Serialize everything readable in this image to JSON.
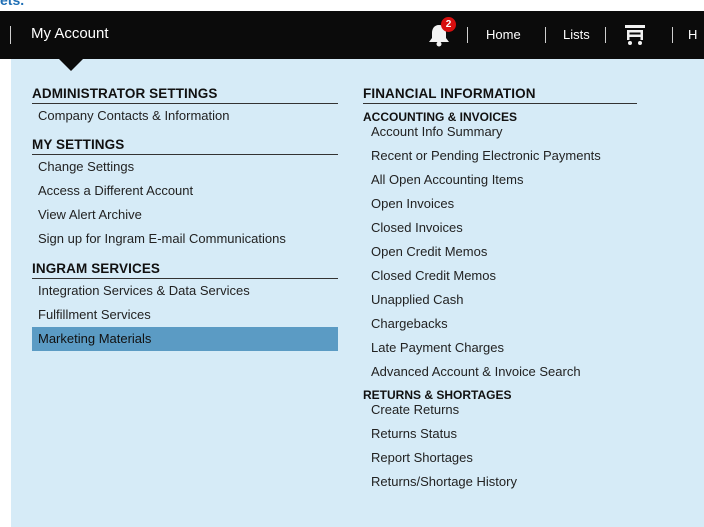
{
  "top_strip": {
    "text": "ets."
  },
  "nav": {
    "account_label": "My Account",
    "notification_count": "2",
    "links": [
      "Home",
      "Lists"
    ],
    "cut_link": "H"
  },
  "admin": {
    "title": "ADMINISTRATOR SETTINGS",
    "items": [
      "Company Contacts & Information"
    ]
  },
  "my_settings": {
    "title": "MY SETTINGS",
    "items": [
      "Change Settings",
      "Access a Different Account",
      "View Alert Archive",
      "Sign up for Ingram E-mail Communications"
    ]
  },
  "ingram_services": {
    "title": "INGRAM SERVICES",
    "items": [
      "Integration Services & Data Services",
      "Fulfillment Services",
      "Marketing Materials"
    ],
    "selected_index": 2
  },
  "financial": {
    "title": "FINANCIAL INFORMATION",
    "accounting": {
      "title": "ACCOUNTING & INVOICES",
      "items": [
        "Account Info Summary",
        "Recent or Pending Electronic Payments",
        "All Open Accounting Items",
        "Open Invoices",
        "Closed Invoices",
        "Open Credit Memos",
        "Closed Credit Memos",
        "Unapplied Cash",
        "Chargebacks",
        "Late Payment Charges",
        "Advanced Account & Invoice Search"
      ]
    },
    "returns": {
      "title": "RETURNS & SHORTAGES",
      "items": [
        "Create Returns",
        "Returns Status",
        "Report Shortages",
        "Returns/Shortage History"
      ]
    }
  },
  "colors": {
    "navbar": "#0b0b0b",
    "panel": "#d6ebf7",
    "selected": "#5b9bc4",
    "badge": "#d80f0f"
  }
}
